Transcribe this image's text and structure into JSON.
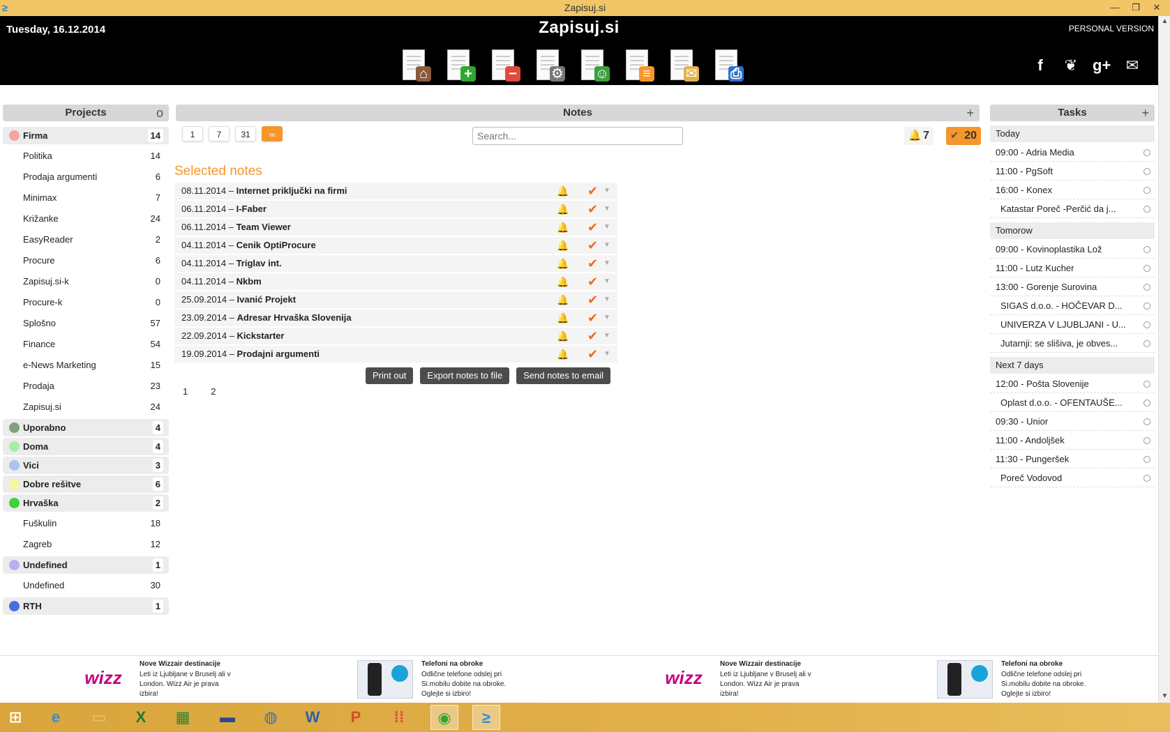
{
  "window": {
    "title": "Zapisuj.si"
  },
  "header": {
    "date": "Tuesday, 16.12.2014",
    "brand": "Zapisuj.si",
    "version": "PERSONAL VERSION",
    "tools": [
      {
        "icon": "home-doc-icon",
        "color": "#8a5a3a",
        "glyph": "⌂"
      },
      {
        "icon": "add-doc-icon",
        "color": "#2ea82e",
        "glyph": "+"
      },
      {
        "icon": "remove-doc-icon",
        "color": "#e14a3a",
        "glyph": "−"
      },
      {
        "icon": "settings-doc-icon",
        "color": "#777777",
        "glyph": "⚙"
      },
      {
        "icon": "user-doc-icon",
        "color": "#3aa03a",
        "glyph": "☺"
      },
      {
        "icon": "list-doc-icon",
        "color": "#f7962b",
        "glyph": "≡"
      },
      {
        "icon": "mail-doc-icon",
        "color": "#e3b24a",
        "glyph": "✉"
      },
      {
        "icon": "print-doc-icon",
        "color": "#2b6fd1",
        "glyph": "⎙"
      }
    ],
    "social": [
      "facebook-icon",
      "twitter-icon",
      "google-plus-icon",
      "mail-icon"
    ]
  },
  "projects": {
    "title": "Projects",
    "toggle": "o",
    "items": [
      {
        "name": "Firma",
        "count": "14",
        "group": true,
        "color": "#f4a4a4"
      },
      {
        "name": "Politika",
        "count": "14"
      },
      {
        "name": "Prodaja argumenti",
        "count": "6"
      },
      {
        "name": "Minimax",
        "count": "7"
      },
      {
        "name": "Križanke",
        "count": "24"
      },
      {
        "name": "EasyReader",
        "count": "2"
      },
      {
        "name": "Procure",
        "count": "6"
      },
      {
        "name": "Zapisuj.si-k",
        "count": "0"
      },
      {
        "name": "Procure-k",
        "count": "0"
      },
      {
        "name": "Splošno",
        "count": "57"
      },
      {
        "name": "Finance",
        "count": "54"
      },
      {
        "name": "e-News Marketing",
        "count": "15"
      },
      {
        "name": "Prodaja",
        "count": "23"
      },
      {
        "name": "Zapisuj.si",
        "count": "24"
      },
      {
        "name": "Uporabno",
        "count": "4",
        "group": true,
        "color": "#7fa07f"
      },
      {
        "name": "Doma",
        "count": "4",
        "group": true,
        "color": "#a6eda6"
      },
      {
        "name": "Vici",
        "count": "3",
        "group": true,
        "color": "#a8c4f4"
      },
      {
        "name": "Dobre rešitve",
        "count": "6",
        "group": true,
        "color": "#f7f7a0"
      },
      {
        "name": "Hrvaška",
        "count": "2",
        "group": true,
        "color": "#3fd13f"
      },
      {
        "name": "Fuškulin",
        "count": "18"
      },
      {
        "name": "Zagreb",
        "count": "12"
      },
      {
        "name": "Undefined",
        "count": "1",
        "group": true,
        "color": "#b7b0f0"
      },
      {
        "name": "Undefined",
        "count": "30"
      },
      {
        "name": "RTH",
        "count": "1",
        "group": true,
        "color": "#4a6de0"
      }
    ]
  },
  "notes": {
    "title": "Notes",
    "add": "+",
    "filters": [
      "1",
      "7",
      "31",
      "∞"
    ],
    "active_filter": 3,
    "search_placeholder": "Search...",
    "bell_count": "7",
    "done_count": "20",
    "selected_title": "Selected notes",
    "items": [
      {
        "date": "08.11.2014",
        "title": "Internet priključki na firmi"
      },
      {
        "date": "06.11.2014",
        "title": "I-Faber"
      },
      {
        "date": "06.11.2014",
        "title": "Team Viewer"
      },
      {
        "date": "04.11.2014",
        "title": "Cenik OptiProcure"
      },
      {
        "date": "04.11.2014",
        "title": "Triglav int."
      },
      {
        "date": "04.11.2014",
        "title": "Nkbm"
      },
      {
        "date": "25.09.2014",
        "title": "Ivanić Projekt"
      },
      {
        "date": "23.09.2014",
        "title": "Adresar Hrvaška Slovenija"
      },
      {
        "date": "22.09.2014",
        "title": "Kickstarter"
      },
      {
        "date": "19.09.2014",
        "title": "Prodajni argumenti"
      }
    ],
    "actions": [
      "Print out",
      "Export notes to file",
      "Send notes to email"
    ],
    "pages": [
      "1",
      "2"
    ]
  },
  "tasks": {
    "title": "Tasks",
    "add": "+",
    "groups": [
      {
        "label": "Today",
        "items": [
          {
            "text": "09:00 - Adria Media"
          },
          {
            "text": "11:00 - PgSoft"
          },
          {
            "text": "16:00 - Konex"
          },
          {
            "text": "Katastar Poreč -Perčić da j...",
            "indent": true
          }
        ]
      },
      {
        "label": "Tomorow",
        "items": [
          {
            "text": "09:00 - Kovinoplastika Lož"
          },
          {
            "text": "11:00 - Lutz Kucher"
          },
          {
            "text": "13:00 - Gorenje Surovina"
          },
          {
            "text": "SIGAS d.o.o. - HOČEVAR D...",
            "indent": true
          },
          {
            "text": "UNIVERZA V LJUBLJANI - U...",
            "indent": true
          },
          {
            "text": "Jutarnji: se slišiva, je obves...",
            "indent": true
          }
        ]
      },
      {
        "label": "Next 7 days",
        "items": [
          {
            "text": "12:00 - Pošta Slovenije"
          },
          {
            "text": "Oplast d.o.o. - OFENTAUŠE...",
            "indent": true
          },
          {
            "text": "09:30 - Unior"
          },
          {
            "text": "11:00 - Andoljšek"
          },
          {
            "text": "11:30 - Pungeršek"
          },
          {
            "text": "Poreč Vodovod",
            "indent": true
          }
        ]
      }
    ]
  },
  "ads": [
    {
      "kind": "wizz",
      "logo": "wizz",
      "title": "Nove Wizzair destinacije",
      "text": "Leti iz Ljubljane v Bruselj ali v London. Wizz Air je prava izbira!"
    },
    {
      "kind": "phone",
      "title": "Telefoni na obroke",
      "text": "Odlične telefone odslej pri Si.mobilu dobite na obroke. Oglejte si izbiro!"
    },
    {
      "kind": "wizz",
      "logo": "wizz",
      "title": "Nove Wizzair destinacije",
      "text": "Leti iz Ljubljane v Bruselj ali v London. Wizz Air je prava izbira!"
    },
    {
      "kind": "phone",
      "title": "Telefoni na obroke",
      "text": "Odlične telefone odslej pri Si.mobilu dobite na obroke. Oglejte si izbiro!"
    }
  ],
  "taskbar": [
    {
      "icon": "start-icon",
      "glyph": "⊞",
      "color": "#ffffff"
    },
    {
      "icon": "internet-explorer-icon",
      "glyph": "e",
      "color": "#2b8fd9"
    },
    {
      "icon": "file-explorer-icon",
      "glyph": "▭",
      "color": "#e8c86a"
    },
    {
      "icon": "excel-icon",
      "glyph": "X",
      "color": "#1f7a3a"
    },
    {
      "icon": "store-icon",
      "glyph": "▦",
      "color": "#1f8a3a"
    },
    {
      "icon": "lenovo-icon",
      "glyph": "▬",
      "color": "#2a4a8a"
    },
    {
      "icon": "intel-icon",
      "glyph": "◍",
      "color": "#2b6fd1"
    },
    {
      "icon": "word-icon",
      "glyph": "W",
      "color": "#2b5fb0"
    },
    {
      "icon": "powerpoint-icon",
      "glyph": "P",
      "color": "#d2502a"
    },
    {
      "icon": "apps-icon",
      "glyph": "⁞⁞",
      "color": "#e14a3a"
    },
    {
      "icon": "chrome-icon",
      "glyph": "◉",
      "color": "#2ea82e",
      "active": true
    },
    {
      "icon": "zapisuj-icon",
      "glyph": "≥",
      "color": "#2b8fd9",
      "active": true
    }
  ]
}
